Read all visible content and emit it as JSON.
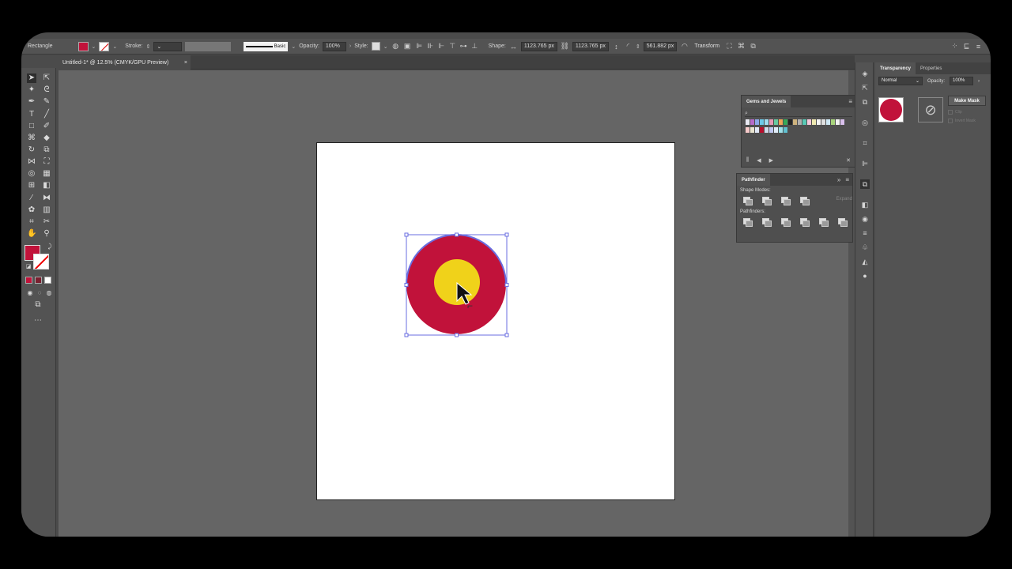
{
  "control_bar": {
    "object_type": "Rectangle",
    "stroke_label": "Stroke:",
    "stroke_profile": "Basic",
    "opacity_label": "Opacity:",
    "opacity_value": "100%",
    "style_label": "Style:",
    "shape_label": "Shape:",
    "width_value": "1123.765 px",
    "height_value": "1123.765 px",
    "corner_value": "561.882 px",
    "transform_label": "Transform",
    "fill_color": "#c1123a"
  },
  "document_tab": {
    "title": "Untitled-1* @ 12.5% (CMYK/GPU Preview)",
    "close": "×"
  },
  "artwork": {
    "outer_circle_color": "#c1123a",
    "inner_circle_color": "#f0d21a",
    "selection_color": "#6a6ee0"
  },
  "gems_panel": {
    "title": "Gems and Jewels",
    "search_icon": "⌕",
    "swatch_colors_row1": [
      "#e8e8f2",
      "#b56bc9",
      "#8aa7e8",
      "#6ec9e8",
      "#9fdcf0",
      "#e89ab6",
      "#65c9a0",
      "#f0a45a",
      "#35a858",
      "#242424",
      "#ceb37e",
      "#b0b0b0",
      "#58c9b5",
      "#f6c9dc",
      "#efe9b0",
      "#f5f5f5",
      "#e0e0e0",
      "#cfe8f5",
      "#a8d47c",
      "#f3f3f3",
      "#d9c0ec"
    ],
    "swatch_colors_row2": [
      "#f5c9c9",
      "#e8e4d0",
      "#e0e8f6",
      "#b7102e",
      "#d0d8e8",
      "#c0c8f0",
      "#e0ecf8",
      "#a0e0e8",
      "#60c0d0"
    ]
  },
  "pathfinder_panel": {
    "title": "Pathfinder",
    "shape_modes_label": "Shape Modes:",
    "expand_label": "Expand",
    "pathfinders_label": "Pathfinders:"
  },
  "transparency_panel": {
    "tab_transparency": "Transparency",
    "tab_properties": "Properties",
    "blend_mode": "Normal",
    "opacity_label": "Opacity:",
    "opacity_value": "100%",
    "make_mask": "Make Mask",
    "clip_label": "Clip",
    "invert_mask_label": "Invert Mask"
  }
}
